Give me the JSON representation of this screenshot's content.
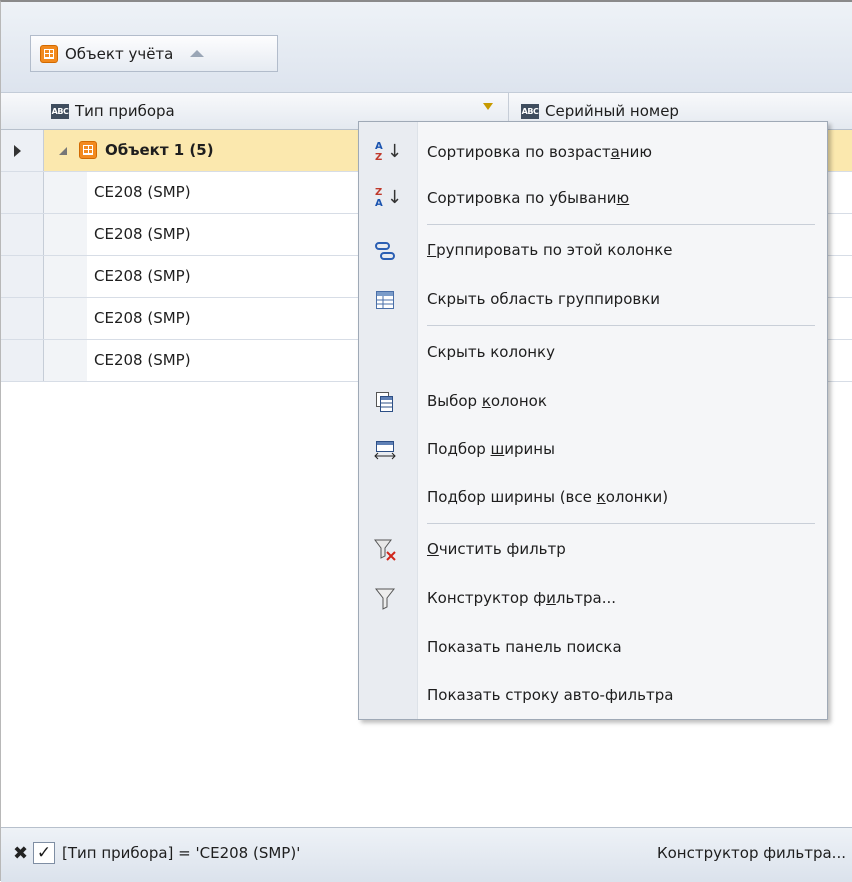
{
  "group_panel": {
    "chip_label": "Объект учёта"
  },
  "header": {
    "col1_label": "Тип прибора",
    "col2_label": "Серийный номер",
    "col_icon_text": "ABC"
  },
  "group_row": {
    "label": "Объект 1 (5)"
  },
  "rows": [
    {
      "device_type": "CE208 (SMP)"
    },
    {
      "device_type": "CE208 (SMP)"
    },
    {
      "device_type": "CE208 (SMP)"
    },
    {
      "device_type": "CE208 (SMP)"
    },
    {
      "device_type": "CE208 (SMP)"
    }
  ],
  "menu": {
    "sort_asc": [
      "Сортировка по возраст",
      "а",
      "нию"
    ],
    "sort_desc": [
      "Сортировка по убывани",
      "ю",
      ""
    ],
    "group_by": [
      "",
      "Г",
      "руппировать по этой колонке"
    ],
    "hide_group_area": "Скрыть область группировки",
    "hide_column": "Скрыть колонку",
    "column_chooser": [
      "Выбор ",
      "к",
      "олонок"
    ],
    "best_fit": [
      "Подбор ",
      "ш",
      "ирины"
    ],
    "best_fit_all": [
      "Подбор ширины (все ",
      "к",
      "олонки)"
    ],
    "clear_filter": [
      "",
      "О",
      "чистить фильтр"
    ],
    "filter_editor": [
      "Конструктор ф",
      "и",
      "льтра..."
    ],
    "show_find_panel": "Показать панель поиска",
    "show_auto_filter": "Показать строку авто-фильтра"
  },
  "filter_bar": {
    "clear_icon": "✖",
    "check_mark": "✓",
    "expression": "[Тип прибора] = 'CE208 (SMP)'",
    "editor_link": "Конструктор фильтра..."
  },
  "icons": [
    "sort-ascending-icon",
    "sort-descending-icon",
    "group-by-icon",
    "group-panel-icon",
    "column-chooser-icon",
    "best-fit-icon",
    "clear-filter-icon",
    "filter-icon"
  ]
}
